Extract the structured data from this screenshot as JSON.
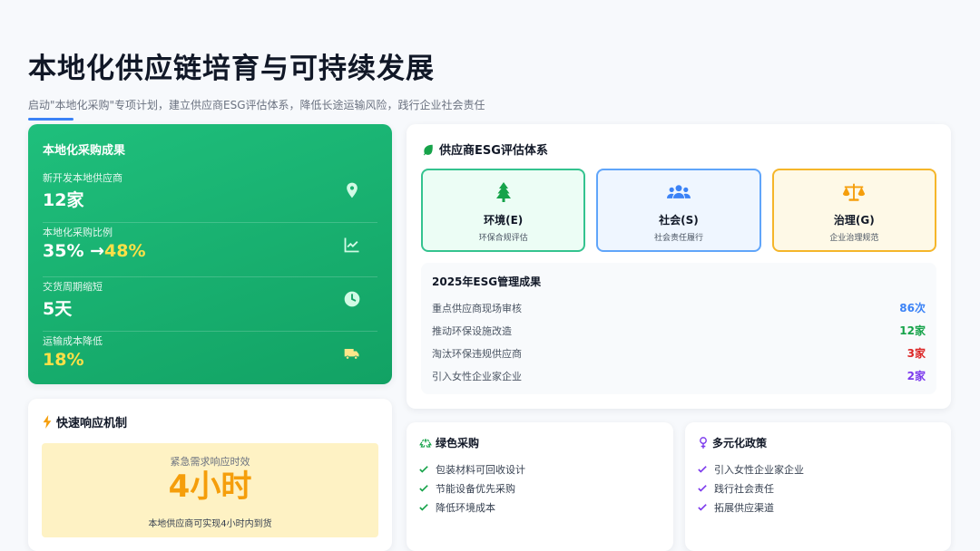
{
  "header": {
    "title": "本地化供应链培育与可持续发展",
    "subtitle": "启动\"本地化采购\"专项计划，建立供应商ESG评估体系，降低长途运输风险，践行企业社会责任"
  },
  "procurement": {
    "title": "本地化采购成果",
    "metrics": [
      {
        "label": "新开发本地供应商",
        "value": "12家",
        "icon": "location-pin-icon"
      },
      {
        "label": "本地化采购比例",
        "value_start": "35%",
        "arrow": "→",
        "value_end": "48%",
        "icon": "line-chart-icon"
      },
      {
        "label": "交货周期缩短",
        "value": "5天",
        "icon": "clock-icon"
      },
      {
        "label": "运输成本降低",
        "value": "18%",
        "icon": "truck-icon"
      }
    ]
  },
  "esg": {
    "title": "供应商ESG评估体系",
    "boxes": [
      {
        "name": "环境(E)",
        "desc": "环保合规评估",
        "icon": "tree-icon",
        "color": "#16a34a"
      },
      {
        "name": "社会(S)",
        "desc": "社会责任履行",
        "icon": "users-icon",
        "color": "#3b82f6"
      },
      {
        "name": "治理(G)",
        "desc": "企业治理规范",
        "icon": "balance-scale-icon",
        "color": "#f59e0b"
      }
    ],
    "results_title": "2025年ESG管理成果",
    "results": [
      {
        "label": "重点供应商现场审核",
        "value": "86次",
        "color": "#3b82f6"
      },
      {
        "label": "推动环保设施改造",
        "value": "12家",
        "color": "#16a34a"
      },
      {
        "label": "淘汰环保违规供应商",
        "value": "3家",
        "color": "#dc2626"
      },
      {
        "label": "引入女性企业家企业",
        "value": "2家",
        "color": "#7c3aed"
      }
    ]
  },
  "quick": {
    "title": "快速响应机制",
    "label": "紧急需求响应时效",
    "value": "4小时",
    "note": "本地供应商可实现4小时内到货"
  },
  "green": {
    "title": "绿色采购",
    "items": [
      "包装材料可回收设计",
      "节能设备优先采购",
      "降低环境成本"
    ]
  },
  "diversity": {
    "title": "多元化政策",
    "items": [
      "引入女性企业家企业",
      "践行社会责任",
      "拓展供应渠道"
    ]
  }
}
